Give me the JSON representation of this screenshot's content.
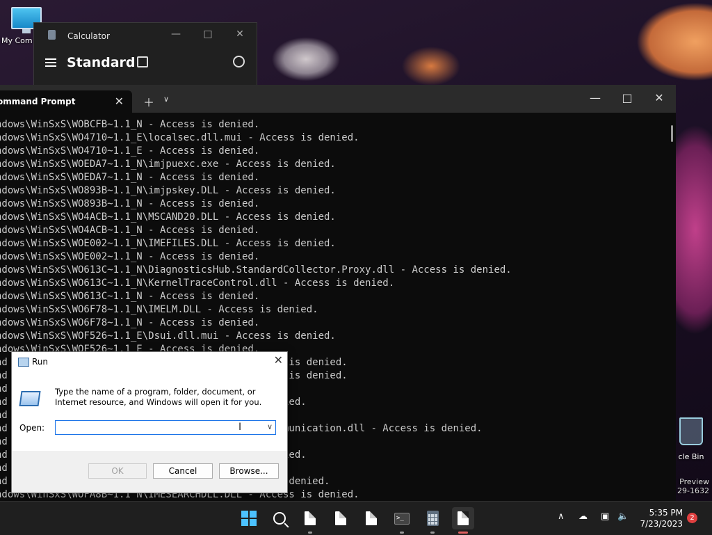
{
  "desktop": {
    "my_computer_label": "My Com",
    "recycle_label": "cle Bin",
    "preview_line1": "Preview",
    "preview_line2": "29-1632"
  },
  "calculator": {
    "title": "Calculator",
    "mode": "Standard"
  },
  "terminal": {
    "tab_title": "ommand Prompt",
    "lines": [
      "ndows\\WinSxS\\WOBCFB~1.1_N - Access is denied.",
      "ndows\\WinSxS\\WO4710~1.1_E\\localsec.dll.mui - Access is denied.",
      "ndows\\WinSxS\\WO4710~1.1_E - Access is denied.",
      "ndows\\WinSxS\\WOEDA7~1.1_N\\imjpuexc.exe - Access is denied.",
      "ndows\\WinSxS\\WOEDA7~1.1_N - Access is denied.",
      "ndows\\WinSxS\\WO893B~1.1_N\\imjpskey.DLL - Access is denied.",
      "ndows\\WinSxS\\WO893B~1.1_N - Access is denied.",
      "ndows\\WinSxS\\WO4ACB~1.1_N\\MSCAND20.DLL - Access is denied.",
      "ndows\\WinSxS\\WO4ACB~1.1_N - Access is denied.",
      "ndows\\WinSxS\\WOE002~1.1_N\\IMEFILES.DLL - Access is denied.",
      "ndows\\WinSxS\\WOE002~1.1_N - Access is denied.",
      "ndows\\WinSxS\\WO613C~1.1_N\\DiagnosticsHub.StandardCollector.Proxy.dll - Access is denied.",
      "ndows\\WinSxS\\WO613C~1.1_N\\KernelTraceControl.dll - Access is denied.",
      "ndows\\WinSxS\\WO613C~1.1_N - Access is denied.",
      "ndows\\WinSxS\\WO6F78~1.1_N\\IMELM.DLL - Access is denied.",
      "ndows\\WinSxS\\WO6F78~1.1_N - Access is denied.",
      "ndows\\WinSxS\\WOF526~1.1_E\\Dsui.dll.mui - Access is denied.",
      "ndows\\WinSxS\\WOF526~1.1_E - Access is denied.",
      "nd                                              s is denied.",
      "nd                                              s is denied.",
      "nd",
      "nd                                         is denied.",
      "nd",
      "nd                                          alCommunication.dll - Access is denied.",
      "nd",
      "nd                                         is denied.",
      "nd",
      "nd                                          ss is denied.",
      "ndows\\WinSxS\\WOFA8B~1.1_N\\IMESEARCHDLL.DLL - Access is denied."
    ]
  },
  "run_dialog": {
    "title": "Run",
    "description": "Type the name of a program, folder, document, or Internet resource, and Windows will open it for you.",
    "open_label": "Open:",
    "input_value": "",
    "ok_label": "OK",
    "cancel_label": "Cancel",
    "browse_label": "Browse..."
  },
  "taskbar": {
    "time": "5:35 PM",
    "date": "7/23/2023",
    "notification_count": "2"
  }
}
